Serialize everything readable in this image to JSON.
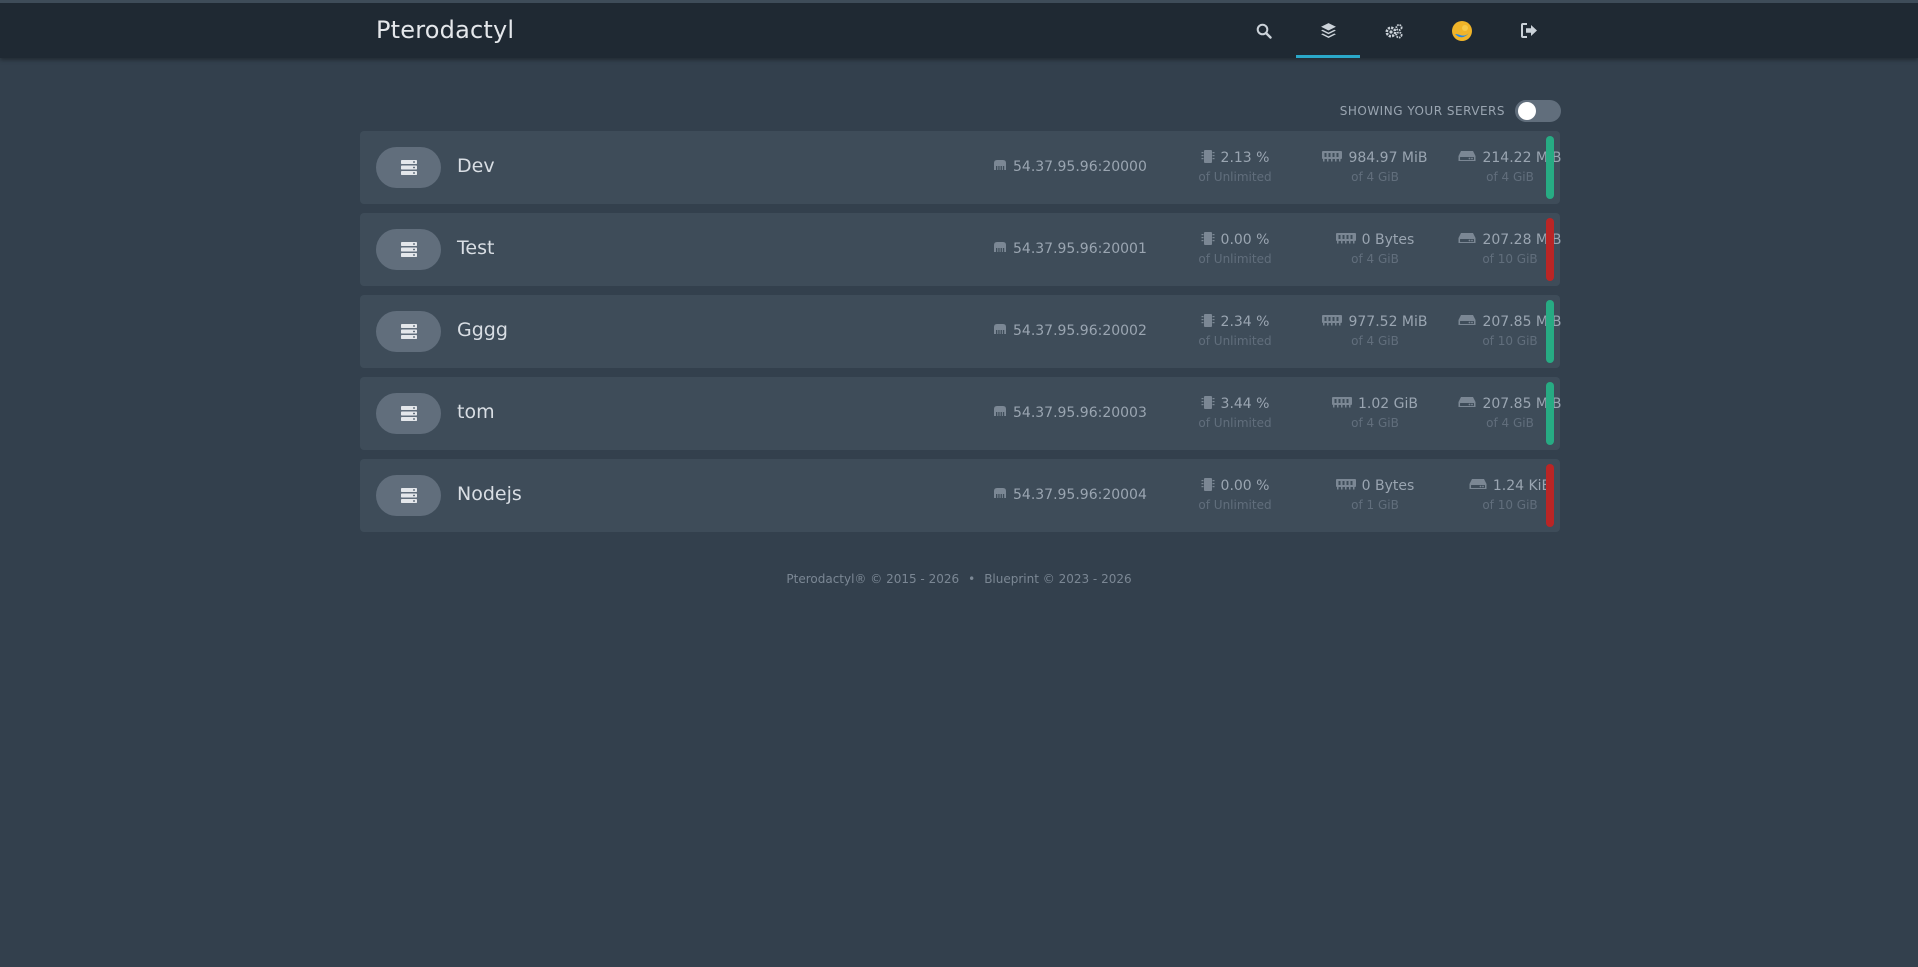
{
  "app": {
    "brand": "Pterodactyl"
  },
  "nav": [
    {
      "icon": "search-icon"
    },
    {
      "icon": "layers-icon",
      "active": true
    },
    {
      "icon": "cogs-icon"
    },
    {
      "icon": "avatar"
    },
    {
      "icon": "sign-out-icon"
    }
  ],
  "colors": {
    "accent": "#2aa8c9",
    "online": "#27ab83",
    "offline": "#ba2525"
  },
  "toggle": {
    "label": "SHOWING YOUR SERVERS",
    "checked": false
  },
  "servers": [
    {
      "name": "Dev",
      "address": "54.37.95.96:20000",
      "cpu": "2.13 %",
      "cpu_limit": "of Unlimited",
      "memory": "984.97 MiB",
      "memory_limit": "of 4 GiB",
      "disk": "214.22 MiB",
      "disk_limit": "of 4 GiB",
      "status": "online"
    },
    {
      "name": "Test",
      "address": "54.37.95.96:20001",
      "cpu": "0.00 %",
      "cpu_limit": "of Unlimited",
      "memory": "0 Bytes",
      "memory_limit": "of 4 GiB",
      "disk": "207.28 MiB",
      "disk_limit": "of 10 GiB",
      "status": "offline"
    },
    {
      "name": "Gggg",
      "address": "54.37.95.96:20002",
      "cpu": "2.34 %",
      "cpu_limit": "of Unlimited",
      "memory": "977.52 MiB",
      "memory_limit": "of 4 GiB",
      "disk": "207.85 MiB",
      "disk_limit": "of 10 GiB",
      "status": "online"
    },
    {
      "name": "tom",
      "address": "54.37.95.96:20003",
      "cpu": "3.44 %",
      "cpu_limit": "of Unlimited",
      "memory": "1.02 GiB",
      "memory_limit": "of 4 GiB",
      "disk": "207.85 MiB",
      "disk_limit": "of 4 GiB",
      "status": "online"
    },
    {
      "name": "Nodejs",
      "address": "54.37.95.96:20004",
      "cpu": "0.00 %",
      "cpu_limit": "of Unlimited",
      "memory": "0 Bytes",
      "memory_limit": "of 1 GiB",
      "disk": "1.24 KiB",
      "disk_limit": "of 10 GiB",
      "status": "offline"
    }
  ],
  "footer": {
    "left": "Pterodactyl® © 2015 - 2026",
    "separator": "•",
    "right": "Blueprint © 2023 - 2026"
  }
}
